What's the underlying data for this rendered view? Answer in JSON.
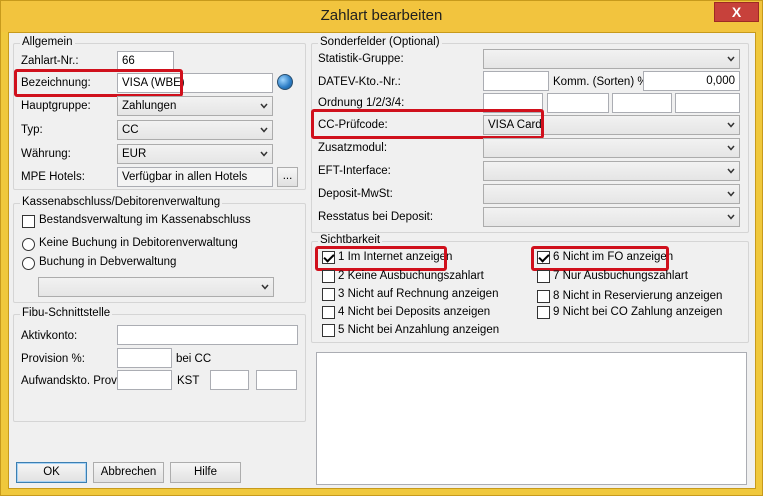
{
  "window": {
    "title": "Zahlart bearbeiten",
    "close": "X"
  },
  "allgemein": {
    "title": "Allgemein",
    "zahlart_nr_label": "Zahlart-Nr.:",
    "zahlart_nr_value": "66",
    "bezeichnung_label": "Bezeichnung:",
    "bezeichnung_value": "VISA (WBE)",
    "hauptgruppe_label": "Hauptgruppe:",
    "hauptgruppe_value": "Zahlungen",
    "typ_label": "Typ:",
    "typ_value": "CC",
    "waehrung_label": "Währung:",
    "waehrung_value": "EUR",
    "mpe_label": "MPE Hotels:",
    "mpe_value": "Verfügbar in allen Hotels",
    "mpe_button": "..."
  },
  "kassen": {
    "title": "Kassenabschluss/Debitorenverwaltung",
    "bestandsverwaltung": "Bestandsverwaltung im Kassenabschluss",
    "keine_buchung": "Keine Buchung in Debitorenverwaltung",
    "buchung_deb": "Buchung in Debverwaltung",
    "combo_value": ""
  },
  "fibu": {
    "title": "Fibu-Schnittstelle",
    "aktivkonto_label": "Aktivkonto:",
    "aktivkonto_value": "",
    "provision_label": "Provision %:",
    "provision_value": "",
    "bei_cc": "bei CC",
    "aufwand_label": "Aufwandskto. Prov.",
    "aufwand_value": "",
    "kst_label": "KST",
    "kst_value_1": "",
    "kst_value_2": ""
  },
  "sonderfelder": {
    "title": "Sonderfelder (Optional)",
    "statistik_label": "Statistik-Gruppe:",
    "statistik_value": "",
    "datev_label": "DATEV-Kto.-Nr.:",
    "datev_value": "",
    "komm_label": "Komm. (Sorten) %:",
    "komm_value": "0,000",
    "ordnung_label": "Ordnung 1/2/3/4:",
    "cc_pruef_label": "CC-Prüfcode:",
    "cc_pruef_value": "VISA Card",
    "zusatzmodul_label": "Zusatzmodul:",
    "eft_label": "EFT-Interface:",
    "deposit_mwst_label": "Deposit-MwSt:",
    "resstatus_label": "Resstatus bei Deposit:"
  },
  "sichtbarkeit": {
    "title": "Sichtbarkeit",
    "items_left": [
      {
        "label": "1 Im Internet anzeigen",
        "checked": true
      },
      {
        "label": "2 Keine Ausbuchungszahlart",
        "checked": false
      },
      {
        "label": "3 Nicht auf Rechnung anzeigen",
        "checked": false
      },
      {
        "label": "4 Nicht bei Deposits anzeigen",
        "checked": false
      },
      {
        "label": "5 Nicht bei Anzahlung anzeigen",
        "checked": false
      }
    ],
    "items_right": [
      {
        "label": "6 Nicht im FO anzeigen",
        "checked": true
      },
      {
        "label": "7 Nur Ausbuchungszahlart",
        "checked": false
      },
      {
        "label": "8 Nicht in Reservierung anzeigen",
        "checked": false
      },
      {
        "label": "9 Nicht bei CO Zahlung anzeigen",
        "checked": false
      }
    ]
  },
  "buttons": {
    "ok": "OK",
    "abbrechen": "Abbrechen",
    "hilfe": "Hilfe"
  },
  "colors": {
    "highlight": "#d0101c",
    "titlebar": "#f2c43e",
    "close": "#c7413b"
  }
}
